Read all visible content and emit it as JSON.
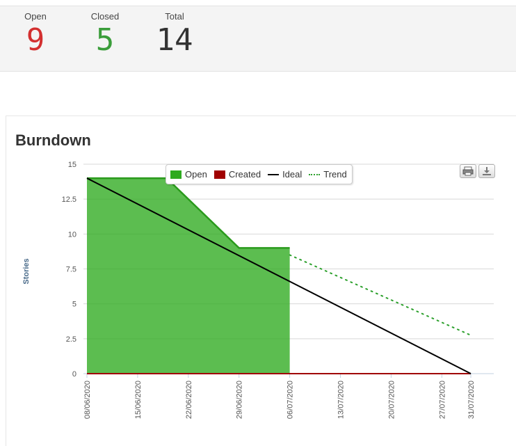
{
  "summary": {
    "open": {
      "label": "Open",
      "value": "9",
      "color": "#d32f2f"
    },
    "closed": {
      "label": "Closed",
      "value": "5",
      "color": "#3a9d3a"
    },
    "total": {
      "label": "Total",
      "value": "14",
      "color": "#333333"
    }
  },
  "panel": {
    "title": "Burndown"
  },
  "toolbar": {
    "print_icon": "print-icon",
    "download_icon": "download-icon"
  },
  "chart_data": {
    "type": "area",
    "title": "Burndown",
    "xlabel": "",
    "ylabel": "Stories",
    "ylim": [
      0,
      15
    ],
    "yticks": [
      0,
      2.5,
      5,
      7.5,
      10,
      12.5,
      15
    ],
    "ytick_labels": [
      "0",
      "2.5",
      "5",
      "7.5",
      "10",
      "12.5",
      "15"
    ],
    "xticks": [
      "08/06/2020",
      "15/06/2020",
      "22/06/2020",
      "29/06/2020",
      "06/07/2020",
      "13/07/2020",
      "20/07/2020",
      "27/07/2020",
      "31/07/2020"
    ],
    "grid": true,
    "legend_position": "top",
    "series": [
      {
        "name": "Open",
        "kind": "area",
        "color": "#2eaa1f",
        "points": [
          [
            "08/06/2020",
            14
          ],
          [
            "19/06/2020",
            14
          ],
          [
            "29/06/2020",
            9
          ],
          [
            "06/07/2020",
            9
          ]
        ]
      },
      {
        "name": "Created",
        "kind": "line",
        "color": "#a00000",
        "points": [
          [
            "08/06/2020",
            0
          ],
          [
            "31/07/2020",
            0
          ]
        ]
      },
      {
        "name": "Ideal",
        "kind": "line",
        "color": "#000000",
        "points": [
          [
            "08/06/2020",
            14
          ],
          [
            "31/07/2020",
            0
          ]
        ]
      },
      {
        "name": "Trend",
        "kind": "dotted",
        "color": "#2ca02c",
        "points": [
          [
            "06/07/2020",
            8.5
          ],
          [
            "31/07/2020",
            2.75
          ]
        ]
      }
    ]
  }
}
